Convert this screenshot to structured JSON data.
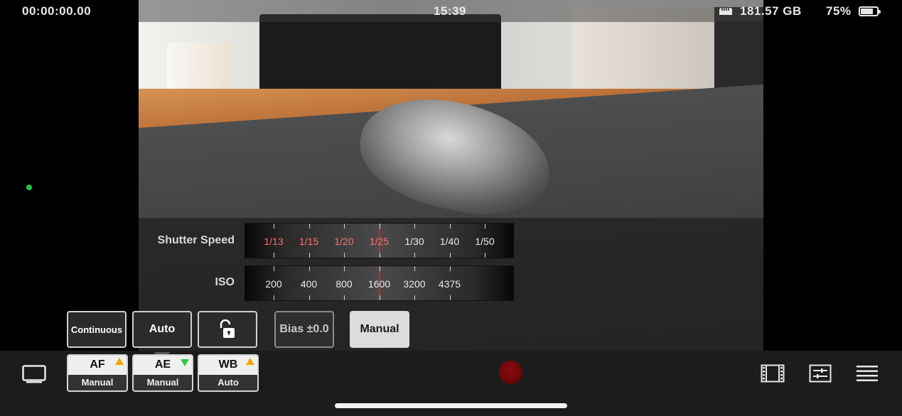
{
  "status_bar": {
    "timecode": "00:00:00.00",
    "clock": "15:39",
    "storage": "181.57 GB",
    "battery": "75%",
    "battery_level": 0.75,
    "storage_icon": "sd-card-icon",
    "battery_icon": "battery-icon"
  },
  "dials": {
    "shutter": {
      "label": "Shutter Speed",
      "values": [
        "1/13",
        "1/15",
        "1/20",
        "1/25",
        "1/30",
        "1/40",
        "1/50"
      ],
      "highlighted": [
        "1/13",
        "1/15",
        "1/20",
        "1/25"
      ],
      "selected": "1/25"
    },
    "iso": {
      "label": "ISO",
      "values": [
        "200",
        "400",
        "800",
        "1600",
        "3200",
        "4375"
      ],
      "selected": "1600"
    }
  },
  "controls": {
    "focus_mode": "Continuous",
    "exposure_mode": "Auto",
    "lock_icon": "unlock-icon",
    "bias": "Bias ±0.0",
    "manual": "Manual"
  },
  "modes": {
    "af": {
      "title": "AF",
      "value": "Manual",
      "indicator": "warning"
    },
    "ae": {
      "title": "AE",
      "value": "Manual",
      "indicator": "ok"
    },
    "wb": {
      "title": "WB",
      "value": "Auto",
      "indicator": "warning"
    }
  },
  "toolbar_icons": {
    "monitor": "monitor-icon",
    "record": "record-icon",
    "film": "film-strip-icon",
    "sliders": "sliders-icon",
    "menu": "menu-icon"
  },
  "colors": {
    "record": "#7a0a0a",
    "warning": "#f0a400",
    "ok": "#2ec44a",
    "needle": "#e02020",
    "highlight_text": "#ff6f6f"
  }
}
